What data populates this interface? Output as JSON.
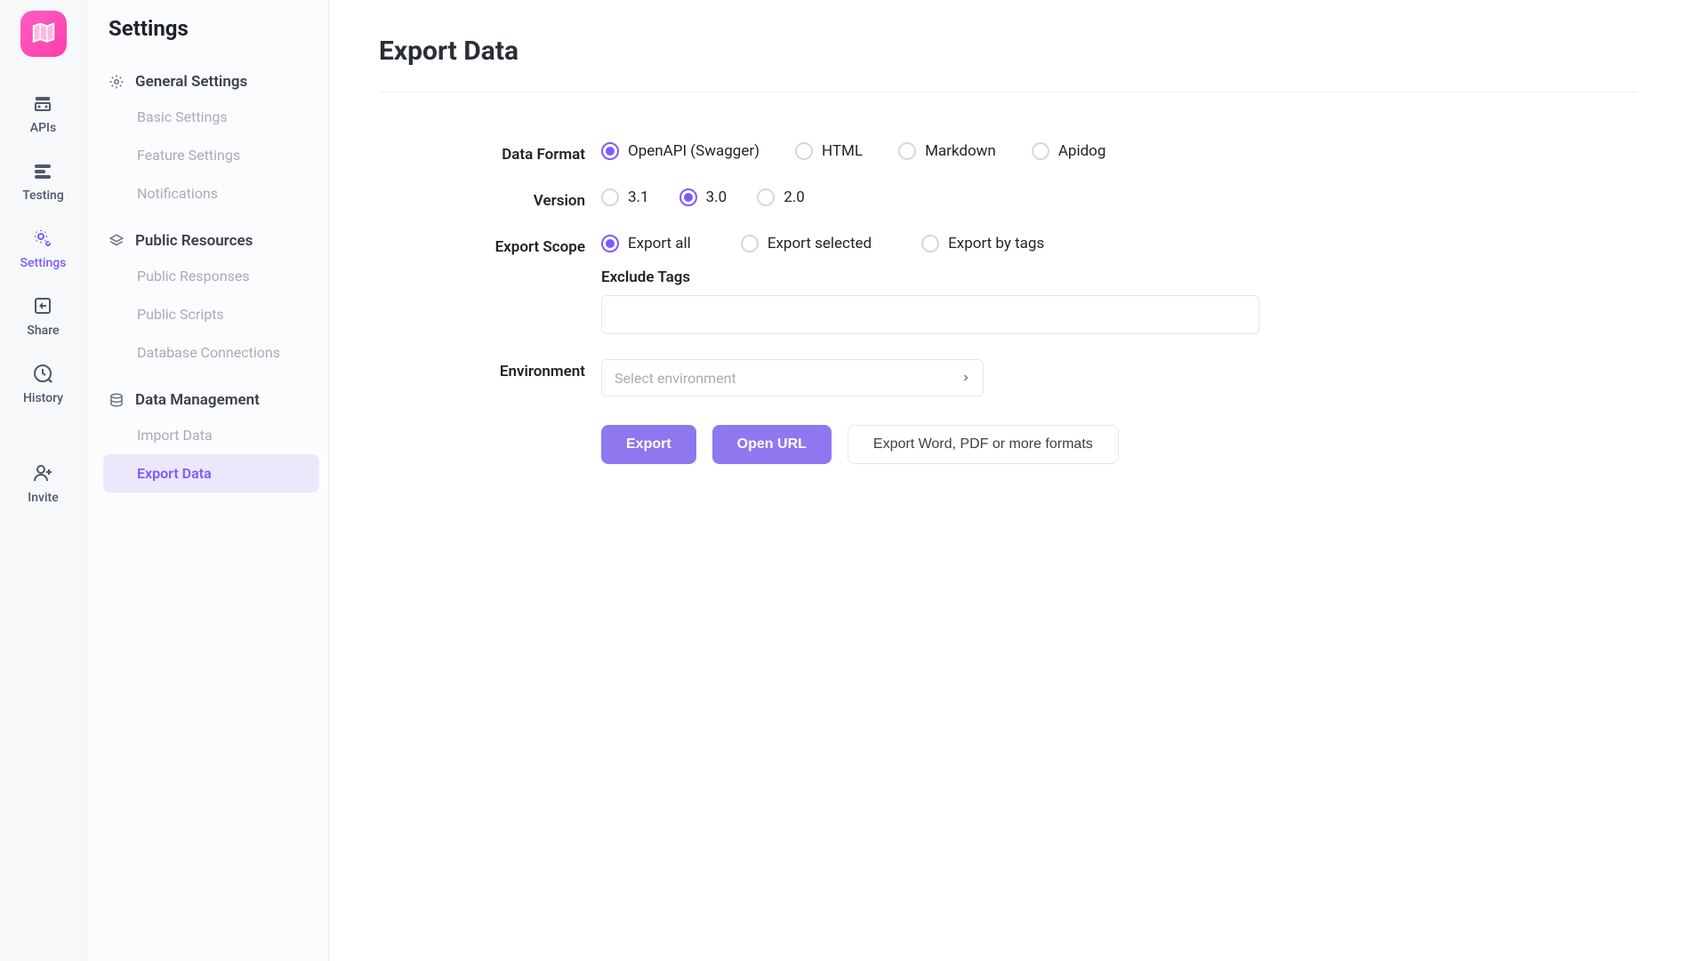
{
  "rail": {
    "items": [
      {
        "label": "APIs"
      },
      {
        "label": "Testing"
      },
      {
        "label": "Settings"
      },
      {
        "label": "Share"
      },
      {
        "label": "History"
      },
      {
        "label": "Invite"
      }
    ]
  },
  "settingsSidebar": {
    "title": "Settings",
    "groups": [
      {
        "label": "General Settings",
        "items": [
          {
            "label": "Basic Settings"
          },
          {
            "label": "Feature Settings"
          },
          {
            "label": "Notifications"
          }
        ]
      },
      {
        "label": "Public Resources",
        "items": [
          {
            "label": "Public Responses"
          },
          {
            "label": "Public Scripts"
          },
          {
            "label": "Database Connections"
          }
        ]
      },
      {
        "label": "Data Management",
        "items": [
          {
            "label": "Import Data"
          },
          {
            "label": "Export Data"
          }
        ]
      }
    ]
  },
  "page": {
    "title": "Export Data",
    "dataFormat": {
      "label": "Data Format",
      "options": [
        {
          "label": "OpenAPI (Swagger)",
          "selected": true
        },
        {
          "label": "HTML",
          "selected": false
        },
        {
          "label": "Markdown",
          "selected": false
        },
        {
          "label": "Apidog",
          "selected": false
        }
      ]
    },
    "version": {
      "label": "Version",
      "options": [
        {
          "label": "3.1",
          "selected": false
        },
        {
          "label": "3.0",
          "selected": true
        },
        {
          "label": "2.0",
          "selected": false
        }
      ]
    },
    "exportScope": {
      "label": "Export Scope",
      "options": [
        {
          "label": "Export all",
          "selected": true
        },
        {
          "label": "Export selected",
          "selected": false
        },
        {
          "label": "Export by tags",
          "selected": false
        }
      ],
      "excludeTagsLabel": "Exclude Tags",
      "excludeTagsValue": ""
    },
    "environment": {
      "label": "Environment",
      "placeholder": "Select environment"
    },
    "buttons": {
      "export": "Export",
      "openUrl": "Open URL",
      "moreFormats": "Export Word, PDF or more formats"
    }
  }
}
